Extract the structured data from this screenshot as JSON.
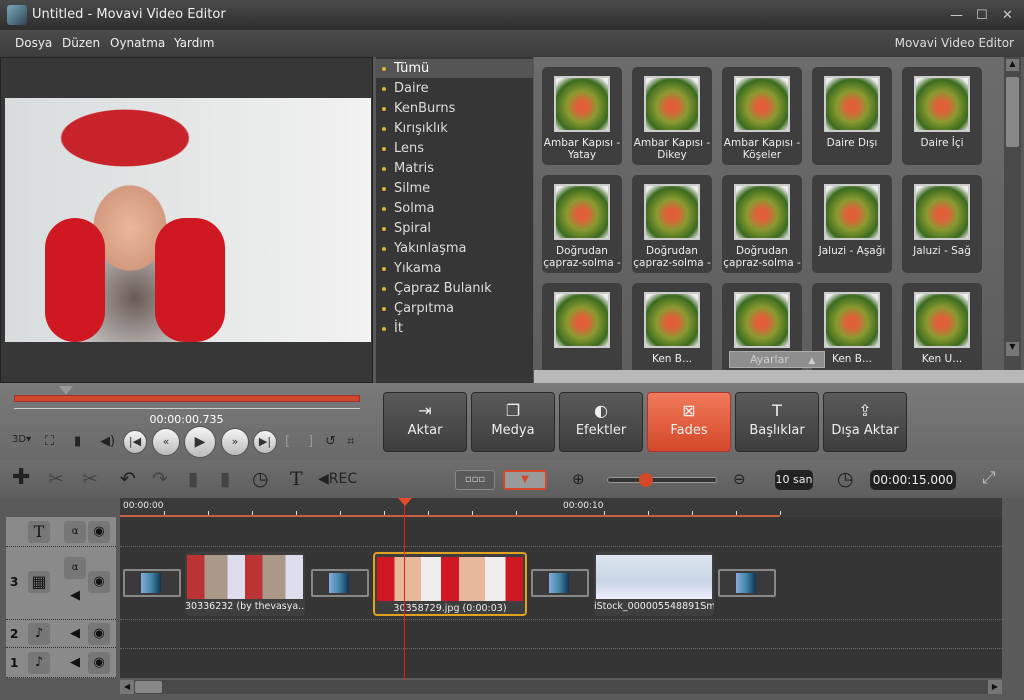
{
  "window": {
    "title": "Untitled - Movavi Video Editor",
    "logo": "Movavi Video Editor",
    "controls": [
      "—",
      "☐",
      "✕"
    ]
  },
  "menu": [
    "Dosya",
    "Düzen",
    "Oynatma",
    "Yardım"
  ],
  "categories": [
    "Tümü",
    "Daire",
    "KenBurns",
    "Kırışıklık",
    "Lens",
    "Matris",
    "Silme",
    "Solma",
    "Spiral",
    "Yakınlaşma",
    "Yıkama",
    "Çapraz Bulanık",
    "Çarpıtma",
    "İt"
  ],
  "selected_category": "Tümü",
  "transitions": [
    "Ambar Kapısı - Yatay",
    "Ambar Kapısı - Dikey",
    "Ambar Kapısı - Köşeler",
    "Daire Dışı",
    "Daire İçi",
    "Doğrudan çapraz-solma -",
    "Doğrudan çapraz-solma -",
    "Doğrudan çapraz-solma -",
    "Jaluzi - Aşağı",
    "Jaluzi - Sağ",
    "",
    "Ken B...",
    "",
    "Ken B...",
    "Ken U..."
  ],
  "settings_label": "Ayarlar",
  "player": {
    "timecode": "00:00:00.735",
    "progress": 0.15
  },
  "tabs": [
    {
      "label": "Aktar",
      "icon": "import-icon"
    },
    {
      "label": "Medya",
      "icon": "media-icon"
    },
    {
      "label": "Efektler",
      "icon": "effects-icon"
    },
    {
      "label": "Fades",
      "icon": "fades-icon",
      "active": true
    },
    {
      "label": "Başlıklar",
      "icon": "titles-icon"
    },
    {
      "label": "Dışa Aktar",
      "icon": "export-icon"
    }
  ],
  "toolbar": {
    "scale": "10 san",
    "duration": "00:00:15.000",
    "zoom_level": 0.35
  },
  "ruler": [
    "00:00:00",
    "00:00:10"
  ],
  "tracks": [
    {
      "num": "",
      "type": "title"
    },
    {
      "num": "3",
      "type": "video"
    },
    {
      "num": "2",
      "type": "audio"
    },
    {
      "num": "1",
      "type": "audio"
    }
  ],
  "clips": [
    "30336232 (by thevasya...",
    "30358729.jpg (0:00:03)",
    "iStock_000005548891Sm..."
  ],
  "accent": "#d4482a"
}
